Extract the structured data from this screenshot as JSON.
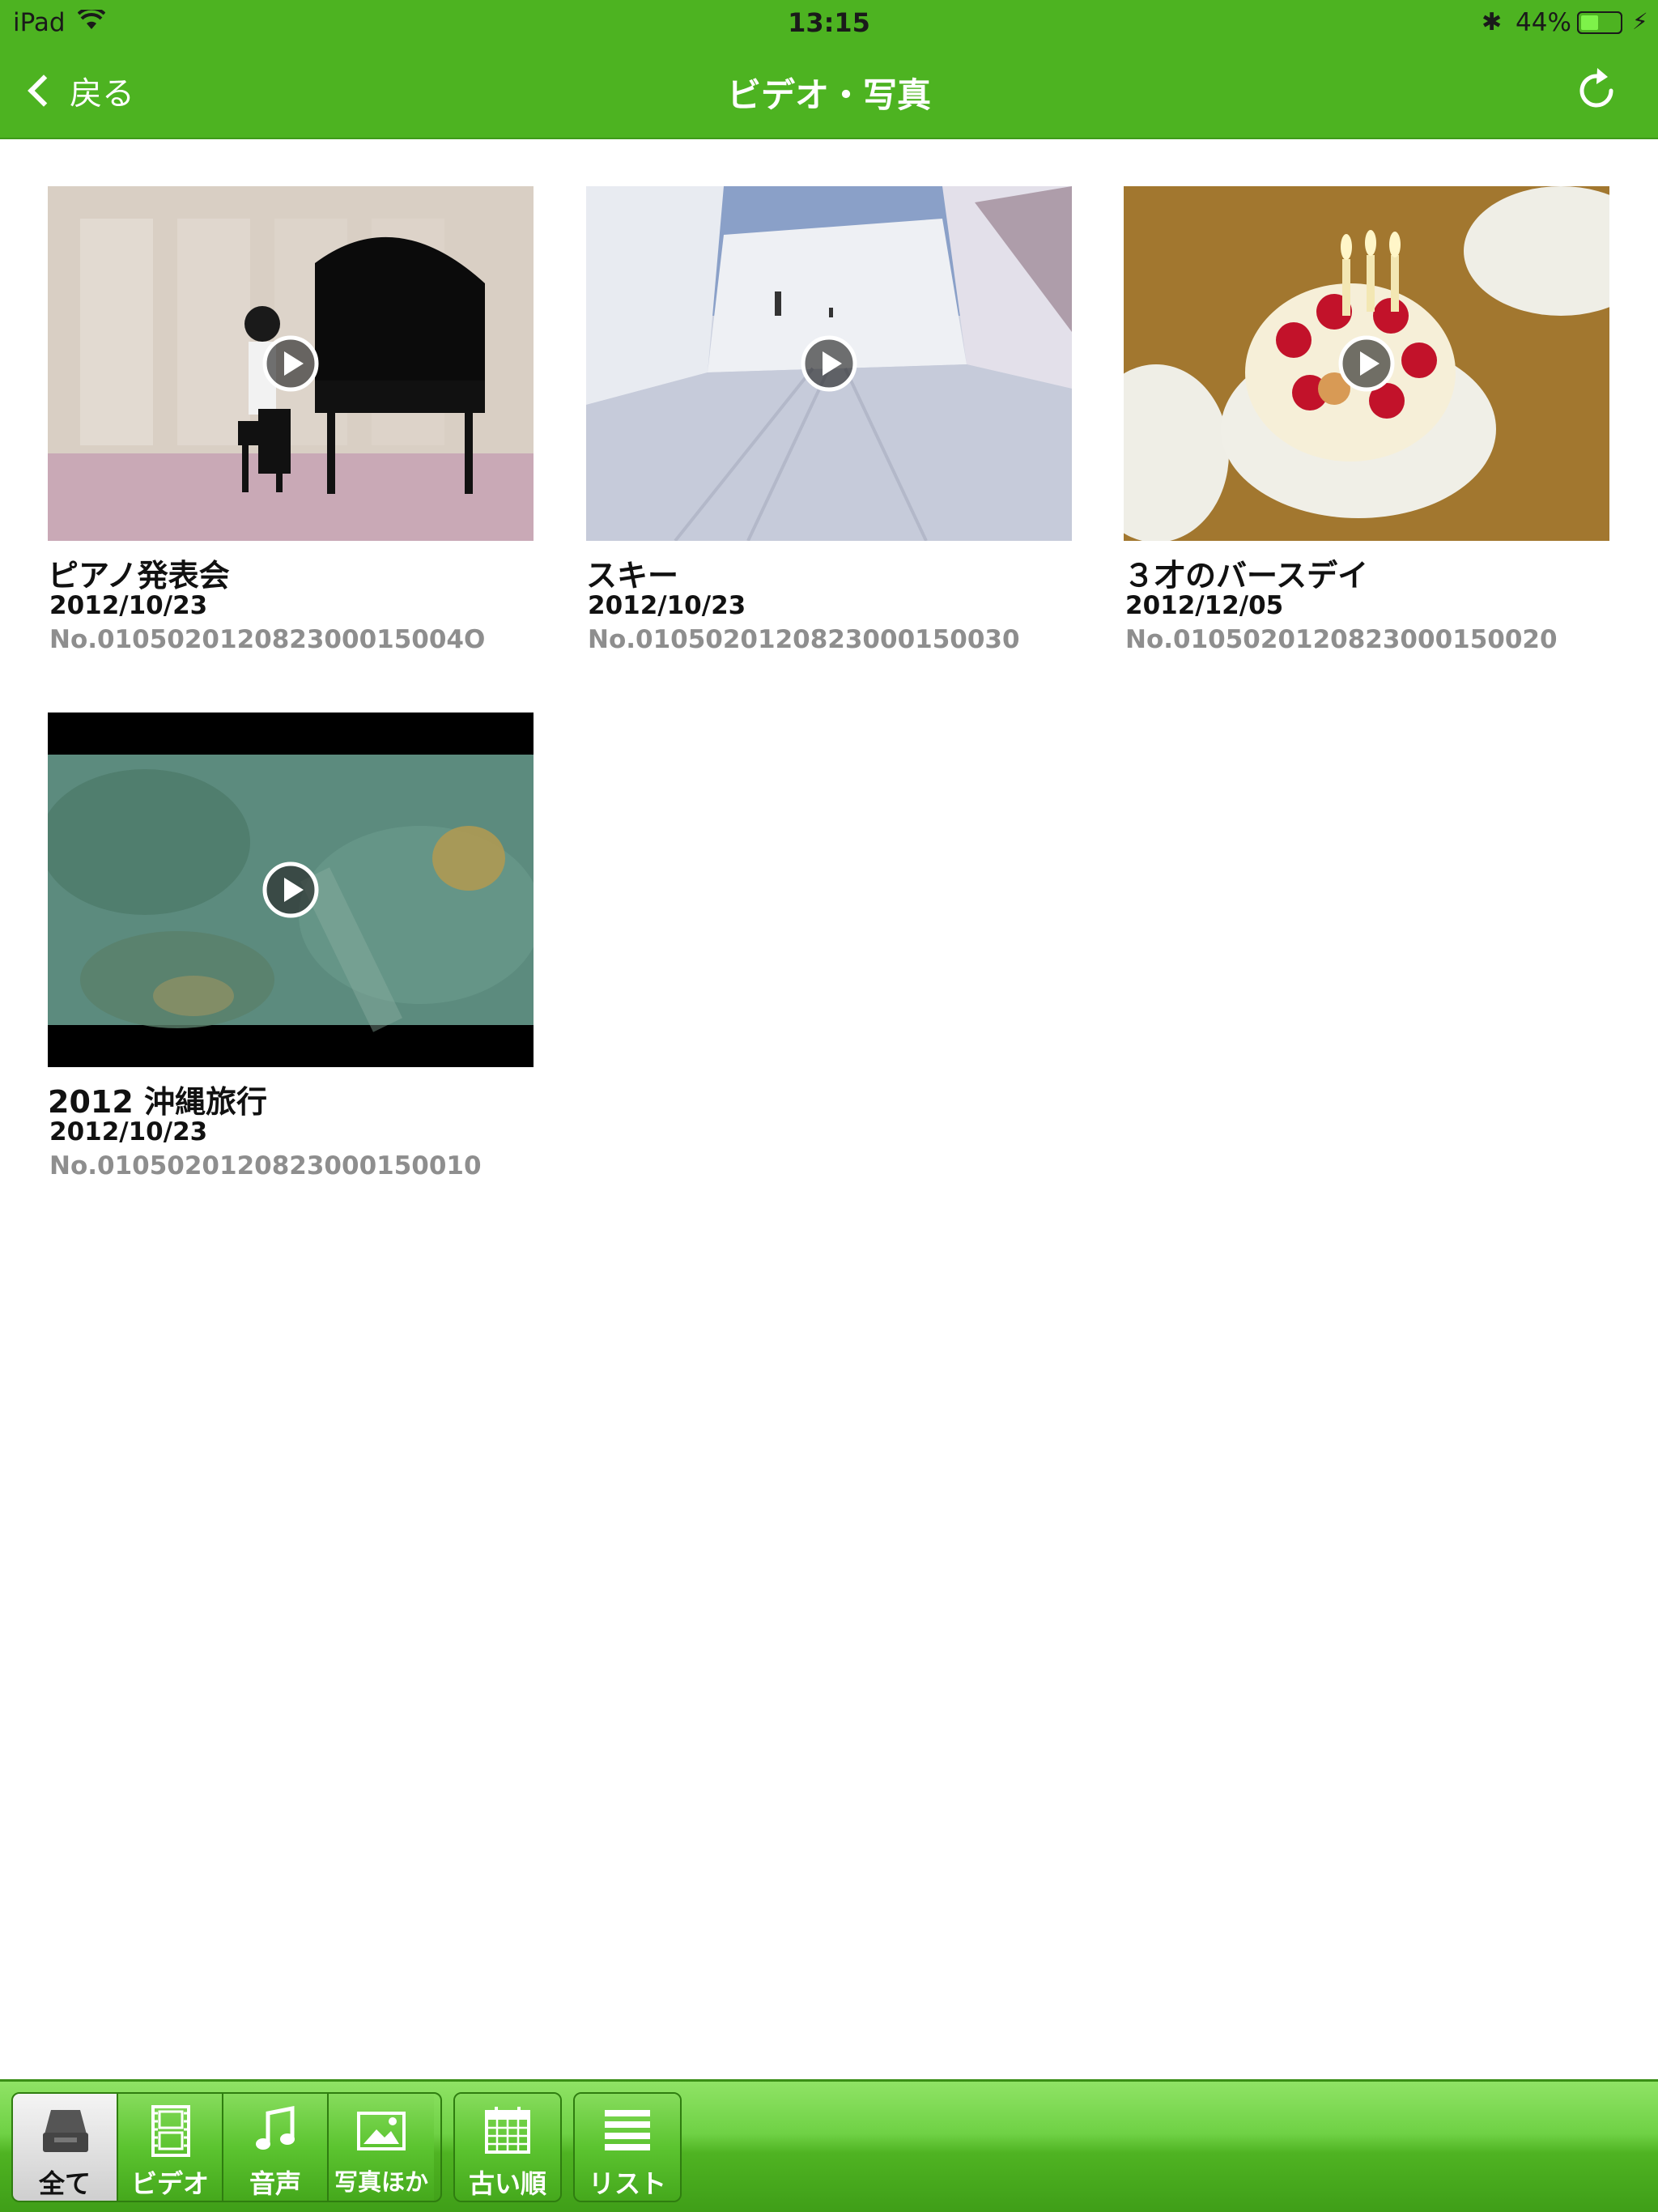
{
  "status_bar": {
    "carrier": "iPad",
    "time": "13:15",
    "battery_percent": "44%",
    "battery_level": 0.44
  },
  "nav": {
    "back_label": "戻る",
    "title": "ビデオ・写真"
  },
  "items": [
    {
      "title": "ピアノ発表会",
      "date": "2012/10/23",
      "number": "No.010502012082300015004O"
    },
    {
      "title": "スキー",
      "date": "2012/10/23",
      "number": "No.0105020120823000150030"
    },
    {
      "title": "３才のバースデイ",
      "date": "2012/12/05",
      "number": "No.0105020120823000150020"
    },
    {
      "title": "2012 沖縄旅行",
      "date": "2012/10/23",
      "number": "No.0105020120823000150010"
    }
  ],
  "toolbar": {
    "filters": [
      {
        "label": "全て",
        "icon": "tray-icon",
        "active": true
      },
      {
        "label": "ビデオ",
        "icon": "film-icon",
        "active": false
      },
      {
        "label": "音声",
        "icon": "music-note-icon",
        "active": false
      },
      {
        "label": "写真ほか",
        "icon": "picture-icon",
        "active": false
      }
    ],
    "sort_label": "古い順",
    "view_label": "リスト"
  },
  "colors": {
    "nav_green": "#4db321",
    "toolbar_green": "#5cc430",
    "secondary_text": "#8e8e8e"
  }
}
